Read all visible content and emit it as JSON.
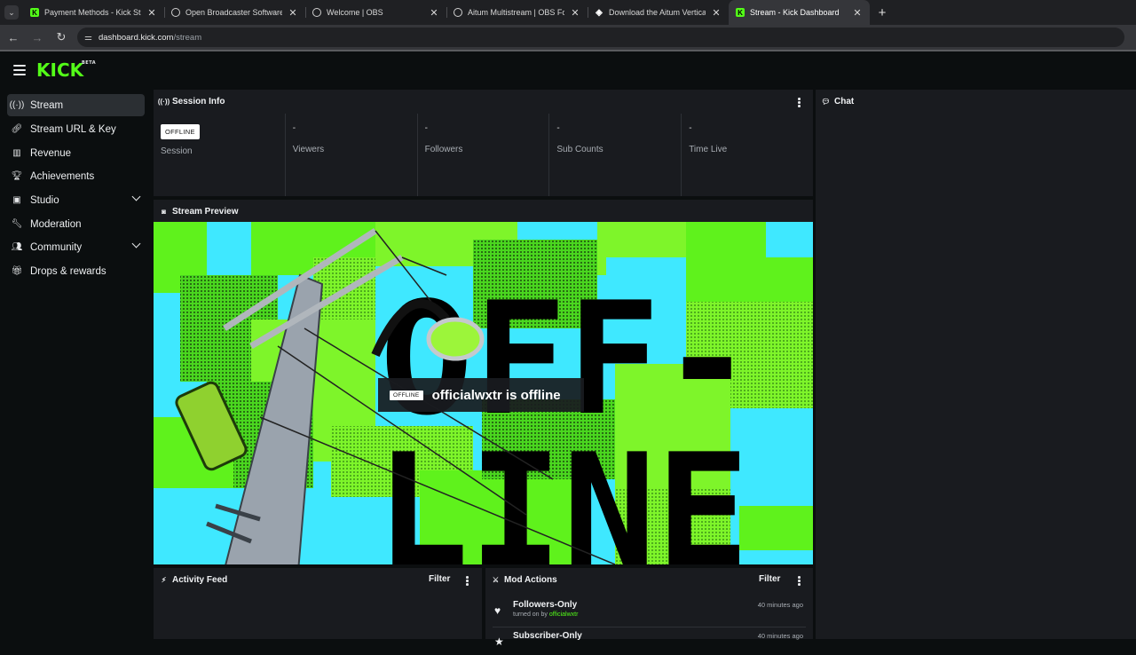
{
  "browser": {
    "tabs": [
      {
        "title": "Payment Methods - Kick Stream",
        "icon": "kick-icon",
        "active": false
      },
      {
        "title": "Open Broadcaster Software | OB",
        "icon": "obs-icon",
        "active": false
      },
      {
        "title": "Welcome | OBS",
        "icon": "obs-icon",
        "active": false
      },
      {
        "title": "Aitum Multistream | OBS Forum",
        "icon": "obs-icon",
        "active": false
      },
      {
        "title": "Download the Aitum Vertical Pl",
        "icon": "aitum-icon",
        "active": false
      },
      {
        "title": "Stream - Kick Dashboard",
        "icon": "kick-icon",
        "active": true
      }
    ],
    "url_host": "dashboard.kick.com",
    "url_path": "/stream"
  },
  "brand": {
    "logo_text": "KICK",
    "logo_tag": "BETA",
    "accent": "#53fc18"
  },
  "sidebar": {
    "items": [
      {
        "label": "Stream",
        "icon": "broadcast-icon",
        "active": true,
        "expandable": false
      },
      {
        "label": "Stream URL & Key",
        "icon": "link-icon",
        "active": false,
        "expandable": false
      },
      {
        "label": "Revenue",
        "icon": "chart-icon",
        "active": false,
        "expandable": false
      },
      {
        "label": "Achievements",
        "icon": "trophy-icon",
        "active": false,
        "expandable": false
      },
      {
        "label": "Studio",
        "icon": "studio-icon",
        "active": false,
        "expandable": true
      },
      {
        "label": "Moderation",
        "icon": "wrench-icon",
        "active": false,
        "expandable": false
      },
      {
        "label": "Community",
        "icon": "users-icon",
        "active": false,
        "expandable": true
      },
      {
        "label": "Drops & rewards",
        "icon": "gift-icon",
        "active": false,
        "expandable": false
      }
    ]
  },
  "session": {
    "title": "Session Info",
    "status_badge": "OFFLINE",
    "session_label": "Session",
    "stats": [
      {
        "value": "-",
        "label": "Viewers"
      },
      {
        "value": "-",
        "label": "Followers"
      },
      {
        "value": "-",
        "label": "Sub Counts"
      },
      {
        "value": "-",
        "label": "Time Live"
      }
    ]
  },
  "preview": {
    "title": "Stream Preview",
    "offline_badge": "OFFLINE",
    "offline_message": "officialwxtr is offline",
    "art_text_top": "OFF-",
    "art_text_bottom": "LINE"
  },
  "chat": {
    "title": "Chat"
  },
  "activity": {
    "title": "Activity Feed",
    "filter_label": "Filter"
  },
  "mod_actions": {
    "title": "Mod Actions",
    "filter_label": "Filter",
    "items": [
      {
        "name": "Followers-Only",
        "sub_prefix": "turned on by",
        "user": "officialwxtr",
        "time": "40 minutes ago",
        "icon": "heart-icon"
      },
      {
        "name": "Subscriber-Only",
        "sub_prefix": "",
        "user": "",
        "time": "40 minutes ago",
        "icon": "star-icon"
      }
    ]
  }
}
